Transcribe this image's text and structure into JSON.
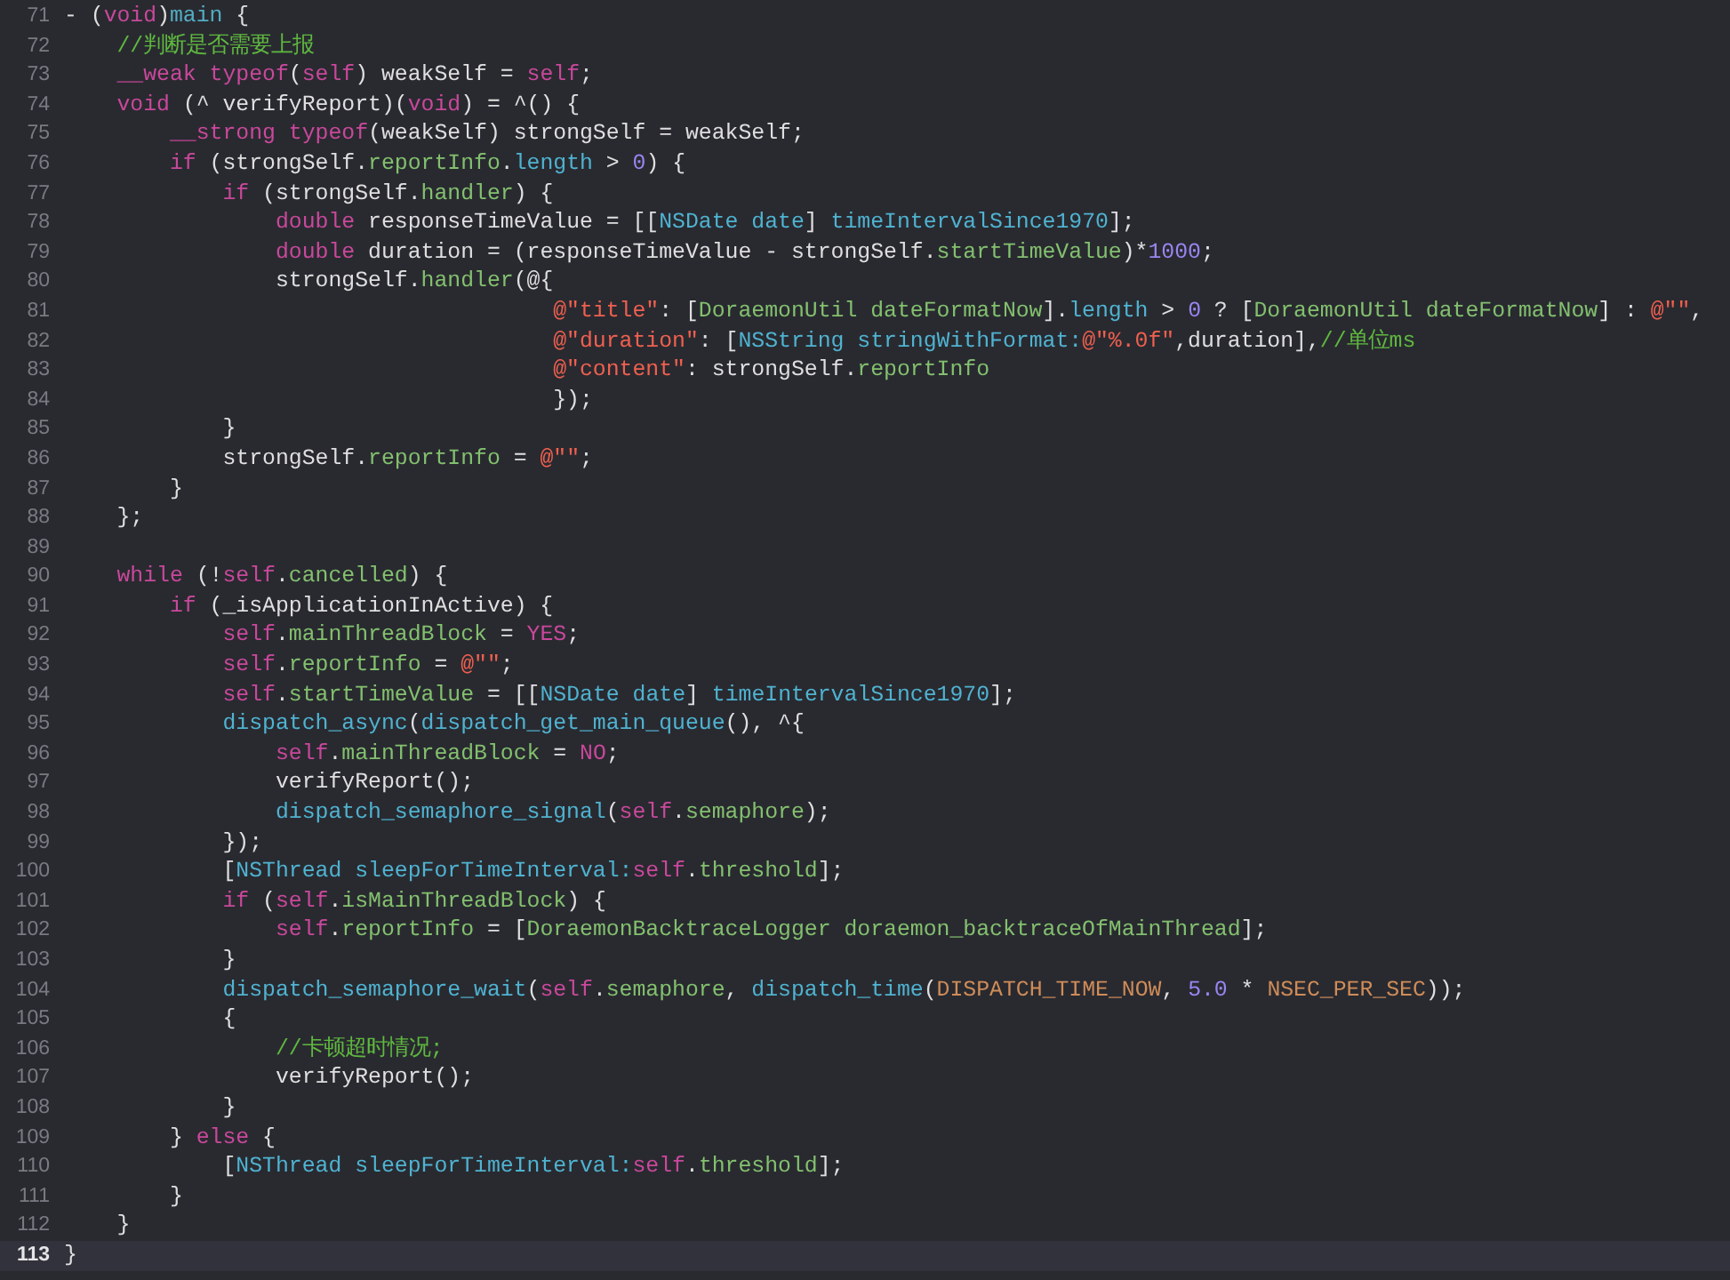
{
  "editor": {
    "lines": [
      {
        "number": "71",
        "highlighted": false,
        "tokens": [
          {
            "text": "- (",
            "kind": "plain"
          },
          {
            "text": "void",
            "kind": "keyword"
          },
          {
            "text": ")",
            "kind": "plain"
          },
          {
            "text": "main",
            "kind": "declaration"
          },
          {
            "text": " {",
            "kind": "plain"
          }
        ]
      },
      {
        "number": "72",
        "highlighted": false,
        "tokens": [
          {
            "text": "    //判断是否需要上报",
            "kind": "comment"
          }
        ]
      },
      {
        "number": "73",
        "highlighted": false,
        "tokens": [
          {
            "text": "    __weak typeof",
            "kind": "keyword"
          },
          {
            "text": "(",
            "kind": "plain"
          },
          {
            "text": "self",
            "kind": "keyword"
          },
          {
            "text": ") weakSelf = ",
            "kind": "plain"
          },
          {
            "text": "self",
            "kind": "keyword"
          },
          {
            "text": ";",
            "kind": "plain"
          }
        ]
      },
      {
        "number": "74",
        "highlighted": false,
        "tokens": [
          {
            "text": "    void",
            "kind": "keyword"
          },
          {
            "text": " (^ verifyReport)(",
            "kind": "plain"
          },
          {
            "text": "void",
            "kind": "keyword"
          },
          {
            "text": ") = ^() {",
            "kind": "plain"
          }
        ]
      },
      {
        "number": "75",
        "highlighted": false,
        "tokens": [
          {
            "text": "        __strong typeof",
            "kind": "keyword"
          },
          {
            "text": "(weakSelf) strongSelf = weakSelf;",
            "kind": "plain"
          }
        ]
      },
      {
        "number": "76",
        "highlighted": false,
        "tokens": [
          {
            "text": "        if",
            "kind": "keyword"
          },
          {
            "text": " (strongSelf.",
            "kind": "plain"
          },
          {
            "text": "reportInfo",
            "kind": "project"
          },
          {
            "text": ".",
            "kind": "plain"
          },
          {
            "text": "length",
            "kind": "system"
          },
          {
            "text": " > ",
            "kind": "plain"
          },
          {
            "text": "0",
            "kind": "number"
          },
          {
            "text": ") {",
            "kind": "plain"
          }
        ]
      },
      {
        "number": "77",
        "highlighted": false,
        "tokens": [
          {
            "text": "            if",
            "kind": "keyword"
          },
          {
            "text": " (strongSelf.",
            "kind": "plain"
          },
          {
            "text": "handler",
            "kind": "project"
          },
          {
            "text": ") {",
            "kind": "plain"
          }
        ]
      },
      {
        "number": "78",
        "highlighted": false,
        "tokens": [
          {
            "text": "                double",
            "kind": "keyword"
          },
          {
            "text": " responseTimeValue = [[",
            "kind": "plain"
          },
          {
            "text": "NSDate date",
            "kind": "system"
          },
          {
            "text": "] ",
            "kind": "plain"
          },
          {
            "text": "timeIntervalSince1970",
            "kind": "system"
          },
          {
            "text": "];",
            "kind": "plain"
          }
        ]
      },
      {
        "number": "79",
        "highlighted": false,
        "tokens": [
          {
            "text": "                double",
            "kind": "keyword"
          },
          {
            "text": " duration = (responseTimeValue - strongSelf.",
            "kind": "plain"
          },
          {
            "text": "startTimeValue",
            "kind": "project"
          },
          {
            "text": ")*",
            "kind": "plain"
          },
          {
            "text": "1000",
            "kind": "number"
          },
          {
            "text": ";",
            "kind": "plain"
          }
        ]
      },
      {
        "number": "80",
        "highlighted": false,
        "tokens": [
          {
            "text": "                strongSelf.",
            "kind": "plain"
          },
          {
            "text": "handler",
            "kind": "project"
          },
          {
            "text": "(@{",
            "kind": "plain"
          }
        ]
      },
      {
        "number": "81",
        "highlighted": false,
        "tokens": [
          {
            "text": "                                     @\"title\"",
            "kind": "string"
          },
          {
            "text": ": [",
            "kind": "plain"
          },
          {
            "text": "DoraemonUtil dateFormatNow",
            "kind": "project"
          },
          {
            "text": "].",
            "kind": "plain"
          },
          {
            "text": "length",
            "kind": "system"
          },
          {
            "text": " > ",
            "kind": "plain"
          },
          {
            "text": "0",
            "kind": "number"
          },
          {
            "text": " ? [",
            "kind": "plain"
          },
          {
            "text": "DoraemonUtil dateFormatNow",
            "kind": "project"
          },
          {
            "text": "] : ",
            "kind": "plain"
          },
          {
            "text": "@\"\"",
            "kind": "string"
          },
          {
            "text": ",",
            "kind": "plain"
          }
        ]
      },
      {
        "number": "82",
        "highlighted": false,
        "tokens": [
          {
            "text": "                                     @\"duration\"",
            "kind": "string"
          },
          {
            "text": ": [",
            "kind": "plain"
          },
          {
            "text": "NSString stringWithFormat:",
            "kind": "system"
          },
          {
            "text": "@\"%.0f\"",
            "kind": "string"
          },
          {
            "text": ",duration],",
            "kind": "plain"
          },
          {
            "text": "//单位ms",
            "kind": "comment"
          }
        ]
      },
      {
        "number": "83",
        "highlighted": false,
        "tokens": [
          {
            "text": "                                     @\"content\"",
            "kind": "string"
          },
          {
            "text": ": strongSelf.",
            "kind": "plain"
          },
          {
            "text": "reportInfo",
            "kind": "project"
          }
        ]
      },
      {
        "number": "84",
        "highlighted": false,
        "tokens": [
          {
            "text": "                                     });",
            "kind": "plain"
          }
        ]
      },
      {
        "number": "85",
        "highlighted": false,
        "tokens": [
          {
            "text": "            }",
            "kind": "plain"
          }
        ]
      },
      {
        "number": "86",
        "highlighted": false,
        "tokens": [
          {
            "text": "            strongSelf.",
            "kind": "plain"
          },
          {
            "text": "reportInfo",
            "kind": "project"
          },
          {
            "text": " = ",
            "kind": "plain"
          },
          {
            "text": "@\"\"",
            "kind": "string"
          },
          {
            "text": ";",
            "kind": "plain"
          }
        ]
      },
      {
        "number": "87",
        "highlighted": false,
        "tokens": [
          {
            "text": "        }",
            "kind": "plain"
          }
        ]
      },
      {
        "number": "88",
        "highlighted": false,
        "tokens": [
          {
            "text": "    };",
            "kind": "plain"
          }
        ]
      },
      {
        "number": "89",
        "highlighted": false
      },
      {
        "number": "90",
        "highlighted": false,
        "tokens": [
          {
            "text": "    while",
            "kind": "keyword"
          },
          {
            "text": " (!",
            "kind": "plain"
          },
          {
            "text": "self",
            "kind": "keyword"
          },
          {
            "text": ".",
            "kind": "plain"
          },
          {
            "text": "cancelled",
            "kind": "project"
          },
          {
            "text": ") {",
            "kind": "plain"
          }
        ]
      },
      {
        "number": "91",
        "highlighted": false,
        "tokens": [
          {
            "text": "        if",
            "kind": "keyword"
          },
          {
            "text": " (_isApplicationInActive) {",
            "kind": "plain"
          }
        ]
      },
      {
        "number": "92",
        "highlighted": false,
        "tokens": [
          {
            "text": "            self",
            "kind": "keyword"
          },
          {
            "text": ".",
            "kind": "plain"
          },
          {
            "text": "mainThreadBlock",
            "kind": "project"
          },
          {
            "text": " = ",
            "kind": "plain"
          },
          {
            "text": "YES",
            "kind": "keyword"
          },
          {
            "text": ";",
            "kind": "plain"
          }
        ]
      },
      {
        "number": "93",
        "highlighted": false,
        "tokens": [
          {
            "text": "            self",
            "kind": "keyword"
          },
          {
            "text": ".",
            "kind": "plain"
          },
          {
            "text": "reportInfo",
            "kind": "project"
          },
          {
            "text": " = ",
            "kind": "plain"
          },
          {
            "text": "@\"\"",
            "kind": "string"
          },
          {
            "text": ";",
            "kind": "plain"
          }
        ]
      },
      {
        "number": "94",
        "highlighted": false,
        "tokens": [
          {
            "text": "            self",
            "kind": "keyword"
          },
          {
            "text": ".",
            "kind": "plain"
          },
          {
            "text": "startTimeValue",
            "kind": "project"
          },
          {
            "text": " = [[",
            "kind": "plain"
          },
          {
            "text": "NSDate date",
            "kind": "system"
          },
          {
            "text": "] ",
            "kind": "plain"
          },
          {
            "text": "timeIntervalSince1970",
            "kind": "system"
          },
          {
            "text": "];",
            "kind": "plain"
          }
        ]
      },
      {
        "number": "95",
        "highlighted": false,
        "tokens": [
          {
            "text": "            dispatch_async",
            "kind": "system"
          },
          {
            "text": "(",
            "kind": "plain"
          },
          {
            "text": "dispatch_get_main_queue",
            "kind": "system"
          },
          {
            "text": "(), ^{",
            "kind": "plain"
          }
        ]
      },
      {
        "number": "96",
        "highlighted": false,
        "tokens": [
          {
            "text": "                self",
            "kind": "keyword"
          },
          {
            "text": ".",
            "kind": "plain"
          },
          {
            "text": "mainThreadBlock",
            "kind": "project"
          },
          {
            "text": " = ",
            "kind": "plain"
          },
          {
            "text": "NO",
            "kind": "keyword"
          },
          {
            "text": ";",
            "kind": "plain"
          }
        ]
      },
      {
        "number": "97",
        "highlighted": false,
        "tokens": [
          {
            "text": "                verifyReport();",
            "kind": "plain"
          }
        ]
      },
      {
        "number": "98",
        "highlighted": false,
        "tokens": [
          {
            "text": "                dispatch_semaphore_signal",
            "kind": "system"
          },
          {
            "text": "(",
            "kind": "plain"
          },
          {
            "text": "self",
            "kind": "keyword"
          },
          {
            "text": ".",
            "kind": "plain"
          },
          {
            "text": "semaphore",
            "kind": "project"
          },
          {
            "text": ");",
            "kind": "plain"
          }
        ]
      },
      {
        "number": "99",
        "highlighted": false,
        "tokens": [
          {
            "text": "            });",
            "kind": "plain"
          }
        ]
      },
      {
        "number": "100",
        "highlighted": false,
        "tokens": [
          {
            "text": "            [",
            "kind": "plain"
          },
          {
            "text": "NSThread sleepForTimeInterval:",
            "kind": "system"
          },
          {
            "text": "self",
            "kind": "keyword"
          },
          {
            "text": ".",
            "kind": "plain"
          },
          {
            "text": "threshold",
            "kind": "project"
          },
          {
            "text": "];",
            "kind": "plain"
          }
        ]
      },
      {
        "number": "101",
        "highlighted": false,
        "tokens": [
          {
            "text": "            if",
            "kind": "keyword"
          },
          {
            "text": " (",
            "kind": "plain"
          },
          {
            "text": "self",
            "kind": "keyword"
          },
          {
            "text": ".",
            "kind": "plain"
          },
          {
            "text": "isMainThreadBlock",
            "kind": "project"
          },
          {
            "text": ") {",
            "kind": "plain"
          }
        ]
      },
      {
        "number": "102",
        "highlighted": false,
        "tokens": [
          {
            "text": "                self",
            "kind": "keyword"
          },
          {
            "text": ".",
            "kind": "plain"
          },
          {
            "text": "reportInfo",
            "kind": "project"
          },
          {
            "text": " = [",
            "kind": "plain"
          },
          {
            "text": "DoraemonBacktraceLogger doraemon_backtraceOfMainThread",
            "kind": "project"
          },
          {
            "text": "];",
            "kind": "plain"
          }
        ]
      },
      {
        "number": "103",
        "highlighted": false,
        "tokens": [
          {
            "text": "            }",
            "kind": "plain"
          }
        ]
      },
      {
        "number": "104",
        "highlighted": false,
        "tokens": [
          {
            "text": "            dispatch_semaphore_wait",
            "kind": "system"
          },
          {
            "text": "(",
            "kind": "plain"
          },
          {
            "text": "self",
            "kind": "keyword"
          },
          {
            "text": ".",
            "kind": "plain"
          },
          {
            "text": "semaphore",
            "kind": "project"
          },
          {
            "text": ", ",
            "kind": "plain"
          },
          {
            "text": "dispatch_time",
            "kind": "system"
          },
          {
            "text": "(",
            "kind": "plain"
          },
          {
            "text": "DISPATCH_TIME_NOW",
            "kind": "macro"
          },
          {
            "text": ", ",
            "kind": "plain"
          },
          {
            "text": "5.0",
            "kind": "number"
          },
          {
            "text": " * ",
            "kind": "plain"
          },
          {
            "text": "NSEC_PER_SEC",
            "kind": "macro"
          },
          {
            "text": "));",
            "kind": "plain"
          }
        ]
      },
      {
        "number": "105",
        "highlighted": false,
        "tokens": [
          {
            "text": "            {",
            "kind": "plain"
          }
        ]
      },
      {
        "number": "106",
        "highlighted": false,
        "tokens": [
          {
            "text": "                //卡顿超时情况;",
            "kind": "comment"
          }
        ]
      },
      {
        "number": "107",
        "highlighted": false,
        "tokens": [
          {
            "text": "                verifyReport();",
            "kind": "plain"
          }
        ]
      },
      {
        "number": "108",
        "highlighted": false,
        "tokens": [
          {
            "text": "            }",
            "kind": "plain"
          }
        ]
      },
      {
        "number": "109",
        "highlighted": false,
        "tokens": [
          {
            "text": "        } ",
            "kind": "plain"
          },
          {
            "text": "else",
            "kind": "keyword"
          },
          {
            "text": " {",
            "kind": "plain"
          }
        ]
      },
      {
        "number": "110",
        "highlighted": false,
        "tokens": [
          {
            "text": "            [",
            "kind": "plain"
          },
          {
            "text": "NSThread sleepForTimeInterval:",
            "kind": "system"
          },
          {
            "text": "self",
            "kind": "keyword"
          },
          {
            "text": ".",
            "kind": "plain"
          },
          {
            "text": "threshold",
            "kind": "project"
          },
          {
            "text": "];",
            "kind": "plain"
          }
        ]
      },
      {
        "number": "111",
        "highlighted": false,
        "tokens": [
          {
            "text": "        }",
            "kind": "plain"
          }
        ]
      },
      {
        "number": "112",
        "highlighted": false,
        "tokens": [
          {
            "text": "    }",
            "kind": "plain"
          }
        ]
      },
      {
        "number": "113",
        "highlighted": true,
        "tokens": [
          {
            "text": "}",
            "kind": "plain"
          }
        ]
      }
    ]
  }
}
